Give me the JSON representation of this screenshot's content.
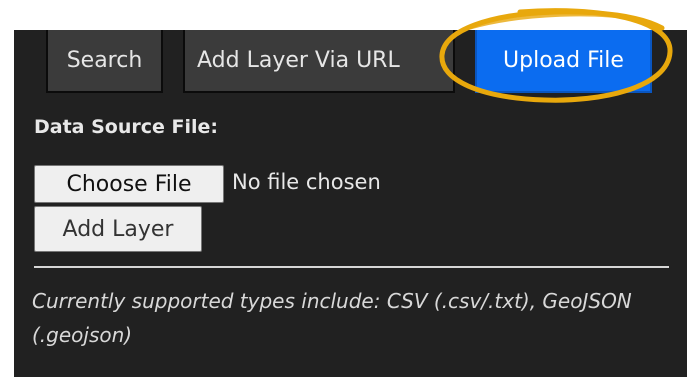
{
  "tabs": [
    {
      "label": "Search",
      "active": false
    },
    {
      "label": "Add Layer Via URL",
      "active": false
    },
    {
      "label": "Upload File",
      "active": true
    }
  ],
  "upload": {
    "section_label": "Data Source File:",
    "choose_button": "Choose File",
    "file_status": "No file chosen",
    "add_button": "Add Layer",
    "note": "Currently supported types include: CSV (.csv/.txt), GeoJSON (.geojson)"
  },
  "colors": {
    "panel_bg": "#212121",
    "tab_bg": "#3b3b3b",
    "active_tab_bg": "#0b6cf0",
    "annotation": "#e8a80c"
  }
}
